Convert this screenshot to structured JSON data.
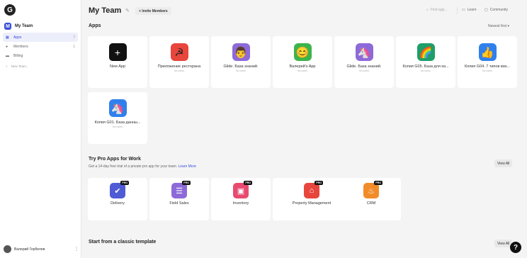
{
  "logo": {
    "letter": "G"
  },
  "sidebar": {
    "team": {
      "badge": "M",
      "name": "My Team"
    },
    "items": [
      {
        "label": "Apps",
        "count": "7",
        "icon": "grid-icon"
      },
      {
        "label": "Members",
        "count": "1",
        "icon": "people-icon"
      },
      {
        "label": "Billing",
        "count": "",
        "icon": "card-icon"
      }
    ],
    "new_team": "New Team...",
    "user": {
      "name": "Валерий Гербелев"
    }
  },
  "header": {
    "title": "My Team",
    "invite_label": "+ Invite Members",
    "search_placeholder": "Find app...",
    "learn_label": "Learn",
    "community_label": "Community"
  },
  "apps": {
    "title": "Apps",
    "sort": "Newest first",
    "new_app_label": "New App",
    "items": [
      {
        "name": "Приложение ресторана",
        "sub": "No users",
        "color": "#e8453c",
        "glyph": "☭"
      },
      {
        "name": "Glide. База знаний.",
        "sub": "No users",
        "color": "#8e6ad8",
        "glyph": "👨"
      },
      {
        "name": "Валерий's App",
        "sub": "No users",
        "color": "#3cb44b",
        "glyph": "😊"
      },
      {
        "name": "Glide. База знаний.",
        "sub": "No users",
        "color": "#8e6ad8",
        "glyph": "🦄"
      },
      {
        "name": "Копия G05. База для ка...",
        "sub": "No users",
        "color": "#1e9e68",
        "glyph": "🌈"
      },
      {
        "name": "Копия G04. 7 типов виз...",
        "sub": "No users",
        "color": "#2f80ed",
        "glyph": "👍"
      },
      {
        "name": "Копия G01. База данны...",
        "sub": "No users",
        "color": "#2f80ed",
        "glyph": "🦄"
      }
    ]
  },
  "pro": {
    "title": "Try Pro Apps for Work",
    "subtitle": "Get a 14-day free trial of a private pro app for your team.",
    "learn_more": "Learn More",
    "view_all": "View All",
    "tag": "PRO",
    "items": [
      {
        "name": "Delivery",
        "color": "#4f5bd5",
        "glyph": "✔"
      },
      {
        "name": "Field Sales",
        "color": "#8e6ad8",
        "glyph": "☰"
      },
      {
        "name": "Inventory",
        "color": "#e84a6f",
        "glyph": "▣"
      },
      {
        "name": "Property Management",
        "color": "#e8453c",
        "glyph": "⌂"
      },
      {
        "name": "CRM",
        "color": "#f28c28",
        "glyph": "♨"
      }
    ]
  },
  "templates": {
    "title": "Start from a classic template",
    "view_all": "View All"
  },
  "help": {
    "label": "?"
  }
}
